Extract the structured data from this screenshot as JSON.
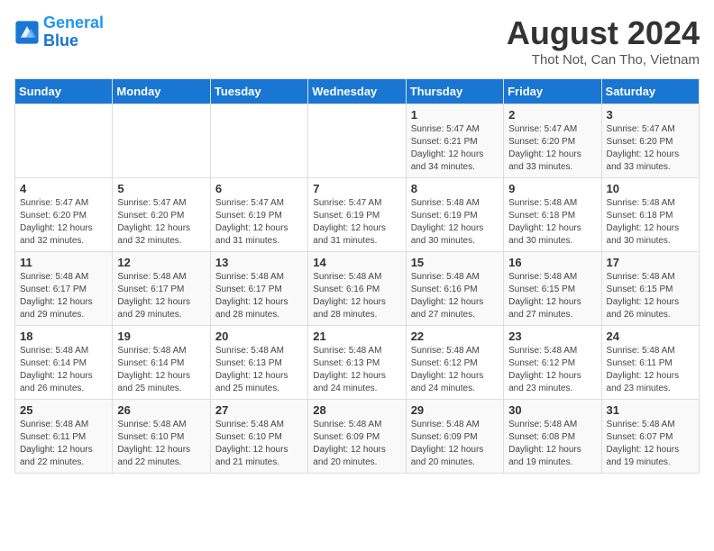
{
  "header": {
    "logo_line1": "General",
    "logo_line2": "Blue",
    "month": "August 2024",
    "location": "Thot Not, Can Tho, Vietnam"
  },
  "weekdays": [
    "Sunday",
    "Monday",
    "Tuesday",
    "Wednesday",
    "Thursday",
    "Friday",
    "Saturday"
  ],
  "weeks": [
    [
      {
        "day": "",
        "info": ""
      },
      {
        "day": "",
        "info": ""
      },
      {
        "day": "",
        "info": ""
      },
      {
        "day": "",
        "info": ""
      },
      {
        "day": "1",
        "info": "Sunrise: 5:47 AM\nSunset: 6:21 PM\nDaylight: 12 hours\nand 34 minutes."
      },
      {
        "day": "2",
        "info": "Sunrise: 5:47 AM\nSunset: 6:20 PM\nDaylight: 12 hours\nand 33 minutes."
      },
      {
        "day": "3",
        "info": "Sunrise: 5:47 AM\nSunset: 6:20 PM\nDaylight: 12 hours\nand 33 minutes."
      }
    ],
    [
      {
        "day": "4",
        "info": "Sunrise: 5:47 AM\nSunset: 6:20 PM\nDaylight: 12 hours\nand 32 minutes."
      },
      {
        "day": "5",
        "info": "Sunrise: 5:47 AM\nSunset: 6:20 PM\nDaylight: 12 hours\nand 32 minutes."
      },
      {
        "day": "6",
        "info": "Sunrise: 5:47 AM\nSunset: 6:19 PM\nDaylight: 12 hours\nand 31 minutes."
      },
      {
        "day": "7",
        "info": "Sunrise: 5:47 AM\nSunset: 6:19 PM\nDaylight: 12 hours\nand 31 minutes."
      },
      {
        "day": "8",
        "info": "Sunrise: 5:48 AM\nSunset: 6:19 PM\nDaylight: 12 hours\nand 30 minutes."
      },
      {
        "day": "9",
        "info": "Sunrise: 5:48 AM\nSunset: 6:18 PM\nDaylight: 12 hours\nand 30 minutes."
      },
      {
        "day": "10",
        "info": "Sunrise: 5:48 AM\nSunset: 6:18 PM\nDaylight: 12 hours\nand 30 minutes."
      }
    ],
    [
      {
        "day": "11",
        "info": "Sunrise: 5:48 AM\nSunset: 6:17 PM\nDaylight: 12 hours\nand 29 minutes."
      },
      {
        "day": "12",
        "info": "Sunrise: 5:48 AM\nSunset: 6:17 PM\nDaylight: 12 hours\nand 29 minutes."
      },
      {
        "day": "13",
        "info": "Sunrise: 5:48 AM\nSunset: 6:17 PM\nDaylight: 12 hours\nand 28 minutes."
      },
      {
        "day": "14",
        "info": "Sunrise: 5:48 AM\nSunset: 6:16 PM\nDaylight: 12 hours\nand 28 minutes."
      },
      {
        "day": "15",
        "info": "Sunrise: 5:48 AM\nSunset: 6:16 PM\nDaylight: 12 hours\nand 27 minutes."
      },
      {
        "day": "16",
        "info": "Sunrise: 5:48 AM\nSunset: 6:15 PM\nDaylight: 12 hours\nand 27 minutes."
      },
      {
        "day": "17",
        "info": "Sunrise: 5:48 AM\nSunset: 6:15 PM\nDaylight: 12 hours\nand 26 minutes."
      }
    ],
    [
      {
        "day": "18",
        "info": "Sunrise: 5:48 AM\nSunset: 6:14 PM\nDaylight: 12 hours\nand 26 minutes."
      },
      {
        "day": "19",
        "info": "Sunrise: 5:48 AM\nSunset: 6:14 PM\nDaylight: 12 hours\nand 25 minutes."
      },
      {
        "day": "20",
        "info": "Sunrise: 5:48 AM\nSunset: 6:13 PM\nDaylight: 12 hours\nand 25 minutes."
      },
      {
        "day": "21",
        "info": "Sunrise: 5:48 AM\nSunset: 6:13 PM\nDaylight: 12 hours\nand 24 minutes."
      },
      {
        "day": "22",
        "info": "Sunrise: 5:48 AM\nSunset: 6:12 PM\nDaylight: 12 hours\nand 24 minutes."
      },
      {
        "day": "23",
        "info": "Sunrise: 5:48 AM\nSunset: 6:12 PM\nDaylight: 12 hours\nand 23 minutes."
      },
      {
        "day": "24",
        "info": "Sunrise: 5:48 AM\nSunset: 6:11 PM\nDaylight: 12 hours\nand 23 minutes."
      }
    ],
    [
      {
        "day": "25",
        "info": "Sunrise: 5:48 AM\nSunset: 6:11 PM\nDaylight: 12 hours\nand 22 minutes."
      },
      {
        "day": "26",
        "info": "Sunrise: 5:48 AM\nSunset: 6:10 PM\nDaylight: 12 hours\nand 22 minutes."
      },
      {
        "day": "27",
        "info": "Sunrise: 5:48 AM\nSunset: 6:10 PM\nDaylight: 12 hours\nand 21 minutes."
      },
      {
        "day": "28",
        "info": "Sunrise: 5:48 AM\nSunset: 6:09 PM\nDaylight: 12 hours\nand 20 minutes."
      },
      {
        "day": "29",
        "info": "Sunrise: 5:48 AM\nSunset: 6:09 PM\nDaylight: 12 hours\nand 20 minutes."
      },
      {
        "day": "30",
        "info": "Sunrise: 5:48 AM\nSunset: 6:08 PM\nDaylight: 12 hours\nand 19 minutes."
      },
      {
        "day": "31",
        "info": "Sunrise: 5:48 AM\nSunset: 6:07 PM\nDaylight: 12 hours\nand 19 minutes."
      }
    ]
  ]
}
